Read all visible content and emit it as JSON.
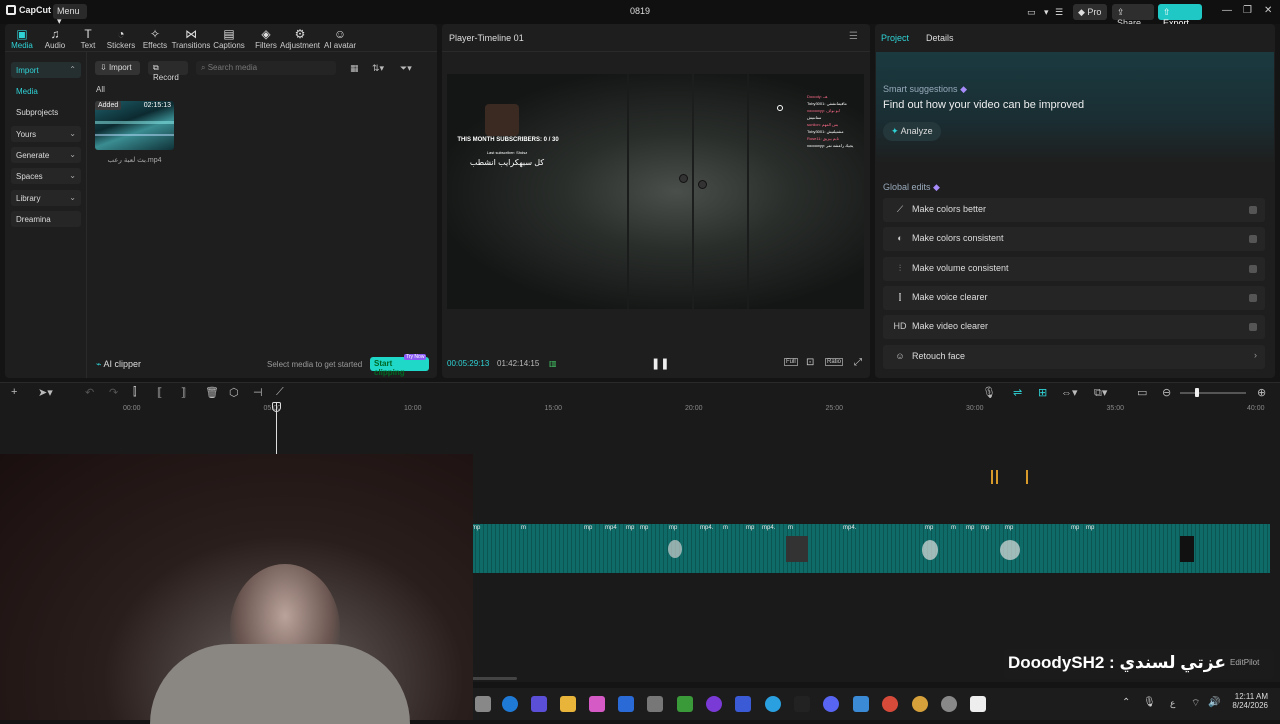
{
  "titlebar": {
    "app_name": "CapCut",
    "menu_label": "Menu ▾",
    "project_title": "0819",
    "pro_label": "Pro",
    "share_label": "Share",
    "export_label": "Export"
  },
  "toolbar": {
    "tabs": [
      {
        "label": "Media",
        "icon": "media-icon"
      },
      {
        "label": "Audio",
        "icon": "audio-icon"
      },
      {
        "label": "Text",
        "icon": "text-icon"
      },
      {
        "label": "Stickers",
        "icon": "sticker-icon"
      },
      {
        "label": "Effects",
        "icon": "effects-icon"
      },
      {
        "label": "Transitions",
        "icon": "transitions-icon"
      },
      {
        "label": "Captions",
        "icon": "captions-icon"
      },
      {
        "label": "Filters",
        "icon": "filters-icon"
      },
      {
        "label": "Adjustment",
        "icon": "adjustment-icon"
      },
      {
        "label": "AI avatar",
        "icon": "avatar-icon"
      }
    ]
  },
  "sidebar": {
    "items": [
      {
        "label": "Import"
      },
      {
        "label": "Media"
      },
      {
        "label": "Subprojects"
      },
      {
        "label": "Yours"
      },
      {
        "label": "Generate"
      },
      {
        "label": "Spaces"
      },
      {
        "label": "Library"
      },
      {
        "label": "Dreamina"
      }
    ]
  },
  "media": {
    "import_label": "Import",
    "record_label": "Record",
    "search_placeholder": "Search media",
    "filter_all": "All",
    "thumb_badge": "Added",
    "thumb_duration": "02:15:13",
    "thumb_name": "بث لعبة رعب.mp4",
    "ai_clipper": "AI clipper",
    "select_hint": "Select media to get started",
    "start_clipping": "Start clipping",
    "try_now": "Try Now"
  },
  "player": {
    "title": "Player-Timeline 01",
    "current_time": "00:05:29:13",
    "total_time": "01:42:14:15",
    "overlay_sub": "THIS MONTH SUBSCRIBERS: 0 / 30",
    "overlay_last": "Last subscriber: Shdsz",
    "overlay_ar": "كل سبهكرايب انشطب",
    "btn_full": "Full",
    "btn_ratio": "Ratio",
    "chat": [
      "Dooody: هــ",
      "Toby3001: مافيتناتشفي",
      "xooooxyy: ابو نواف",
      "ستانتيش",
      "sunlion: بس المهم",
      "Toby3001: مشتيلتيش",
      "Rose11: تايم بيزيق",
      "xooooxyy: يجيك راعشة تمر"
    ]
  },
  "right_panel": {
    "tab_project": "Project",
    "tab_details": "Details",
    "smart_title": "Smart suggestions",
    "smart_desc": "Find out how your video can be improved",
    "analyze": "Analyze",
    "global_title": "Global edits",
    "edits": [
      {
        "label": "Make colors better",
        "icon": "magic-wand-icon"
      },
      {
        "label": "Make colors consistent",
        "icon": "palette-icon"
      },
      {
        "label": "Make volume consistent",
        "icon": "volume-sliders-icon"
      },
      {
        "label": "Make voice clearer",
        "icon": "voice-icon"
      },
      {
        "label": "Make video clearer",
        "icon": "hd-icon"
      },
      {
        "label": "Retouch face",
        "icon": "face-icon"
      }
    ]
  },
  "timeline": {
    "ruler": [
      "00:00",
      "05:00",
      "10:00",
      "15:00",
      "20:00",
      "25:00",
      "30:00",
      "35:00",
      "40:00"
    ],
    "clip_labels": [
      "mp",
      "m",
      "mp",
      "mp4",
      "mp",
      "mp",
      "mp",
      "mp4.",
      "m",
      "mp",
      "mp4.",
      "m",
      "mp4.",
      "mp",
      "m",
      "mp",
      "mp",
      "mp",
      "mp",
      "mp"
    ]
  },
  "stream_overlay": {
    "name_text": "DooodySH2 : عزتي لسندي",
    "watermark": "EditPilot"
  },
  "taskbar": {
    "time": "12:11 AM",
    "date": "8/24/2026",
    "lang": "ع"
  },
  "colors": {
    "accent": "#2fd3d6",
    "teal_clip": "#0f6f6c",
    "bg": "#141414",
    "panel": "#1e1e1e"
  }
}
